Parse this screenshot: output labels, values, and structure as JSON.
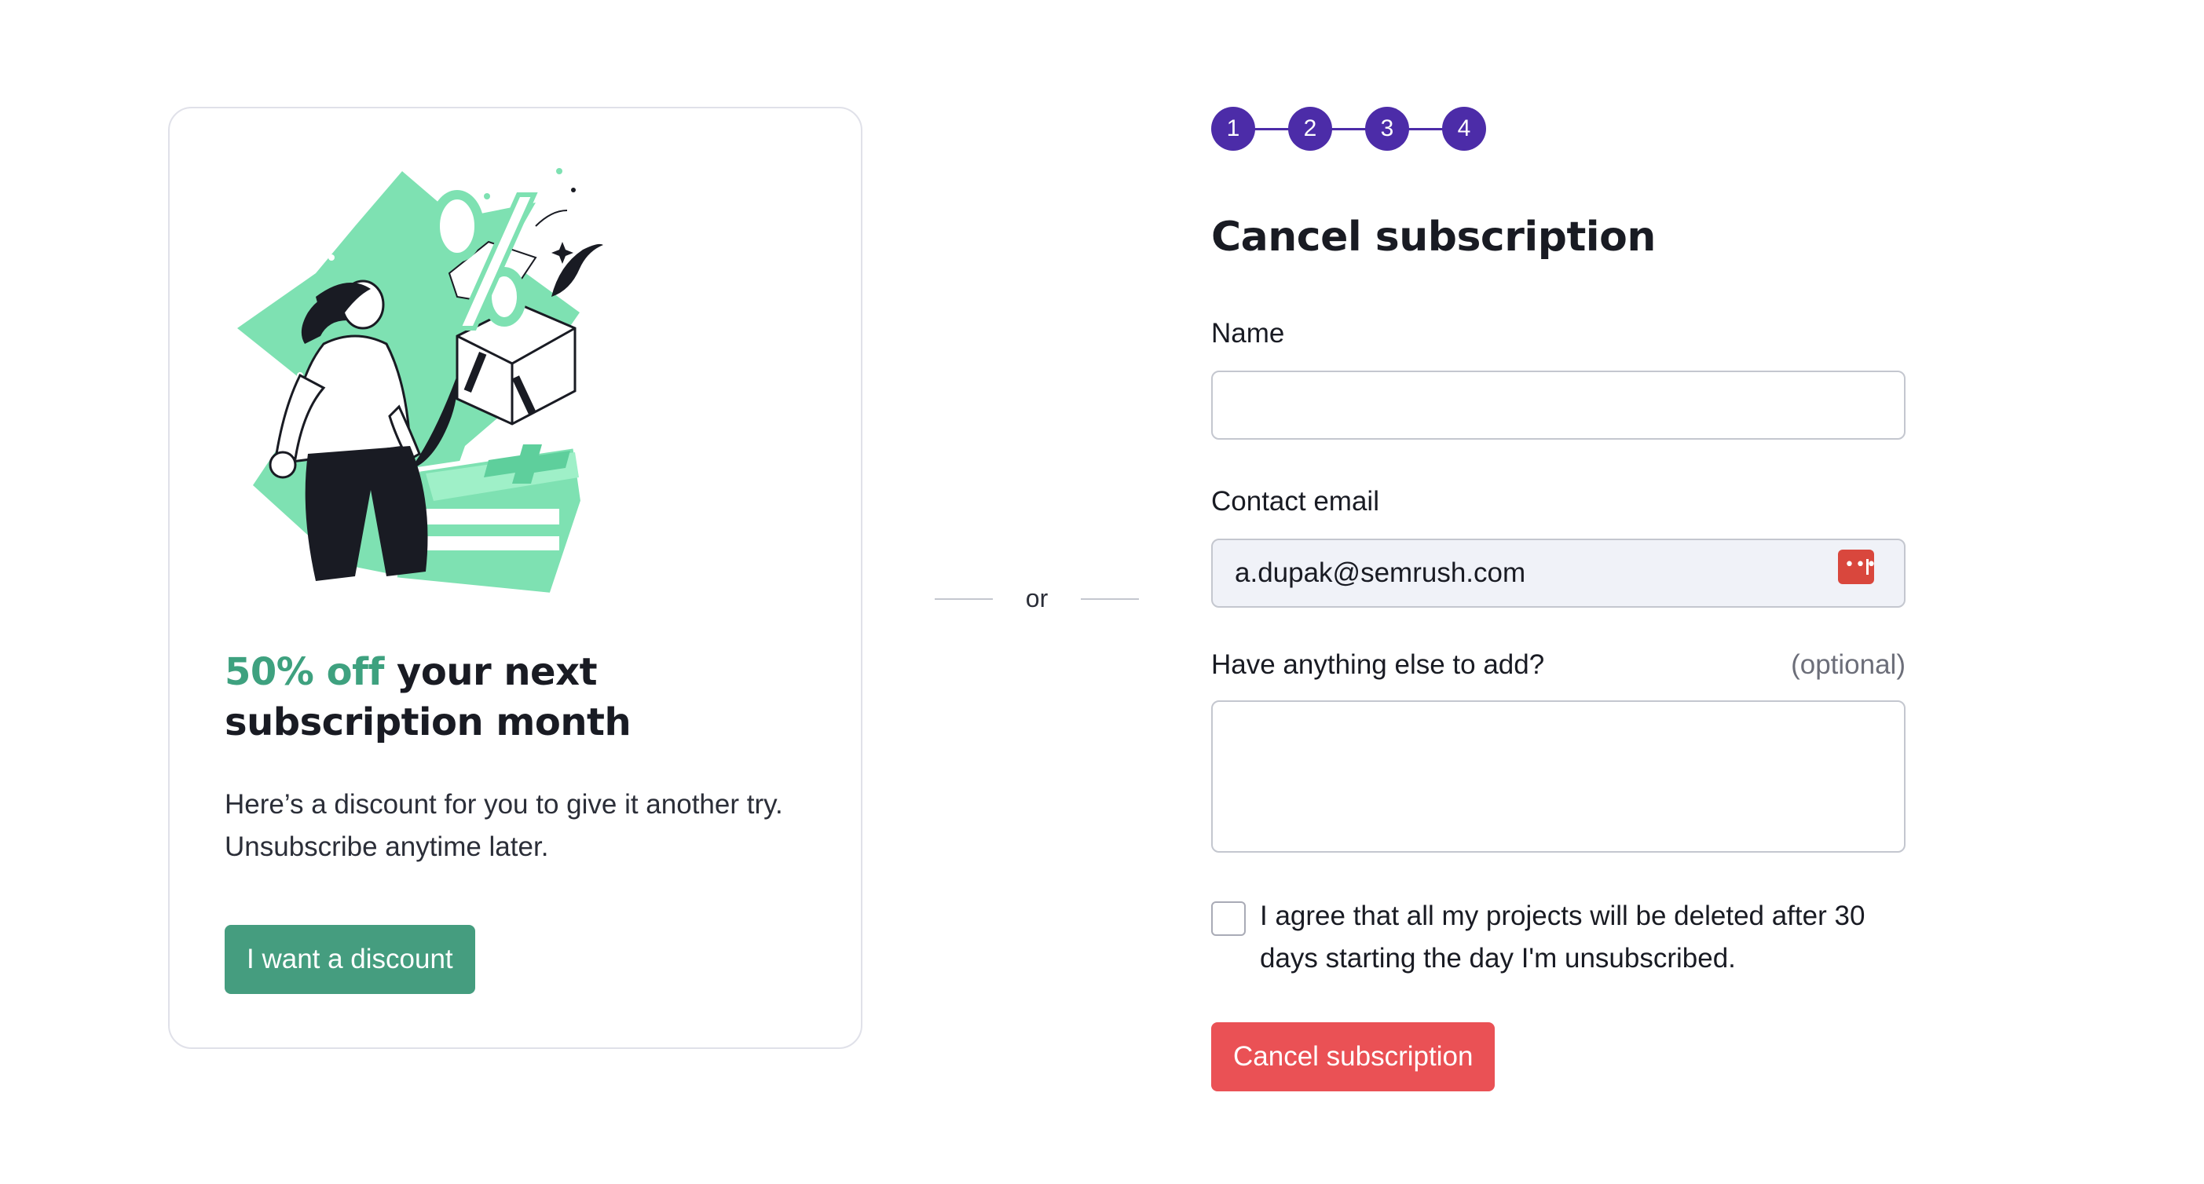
{
  "offer": {
    "title_accent": "50% off",
    "title_rest": " your next subscription month",
    "description": "Here’s a discount for you to give it another try. Unsubscribe anytime later.",
    "button_label": "I want a discount",
    "illustration_icon": "discount-gift-box-illustration"
  },
  "divider": {
    "label": "or"
  },
  "stepper": {
    "steps": [
      "1",
      "2",
      "3",
      "4"
    ]
  },
  "form": {
    "title": "Cancel subscription",
    "name": {
      "label": "Name",
      "value": ""
    },
    "email": {
      "label": "Contact email",
      "value": "a.dupak@semrush.com",
      "autofill_icon": "password-manager-icon"
    },
    "comment": {
      "label": "Have anything else to add?",
      "optional_label": "(optional)",
      "value": ""
    },
    "agreement": {
      "checked": false,
      "text": "I agree that all my projects will be deleted after 30 days starting the day I'm unsubscribed."
    },
    "submit_label": "Cancel subscription"
  },
  "colors": {
    "brand_green": "#459d7f",
    "accent_text_green": "#3ea17f",
    "illustration_green": "#7ee1b2",
    "step_purple": "#4c2ca8",
    "danger_red": "#ea5155",
    "autofill_red": "#d9473d"
  }
}
